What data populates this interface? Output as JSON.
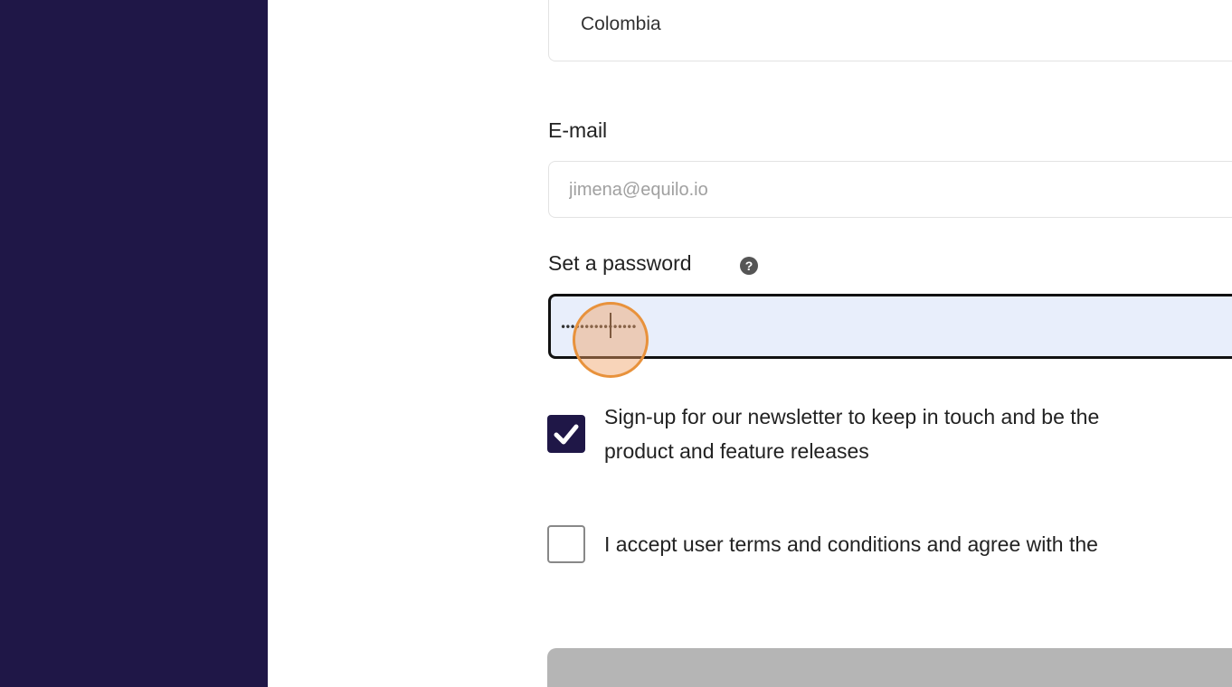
{
  "sidebar": {
    "background_color": "#1f1747"
  },
  "form": {
    "country": {
      "value": "Colombia"
    },
    "email": {
      "label": "E-mail",
      "placeholder": "jimena@equilo.io"
    },
    "password": {
      "label": "Set a password",
      "help_icon": "question-circle-icon",
      "value": "••••••••••••••••",
      "state": "focused"
    },
    "newsletter": {
      "checked": true,
      "text_line1": "Sign-up for our newsletter to keep in touch and be the",
      "text_line2": "product and feature releases"
    },
    "terms": {
      "checked": false,
      "text": "I accept user terms and conditions and agree with the"
    },
    "submit": {
      "state": "disabled",
      "color": "#b5b5b5"
    }
  },
  "colors": {
    "accent": "#1f1747",
    "focus_background": "#e8eefb",
    "click_indicator": "#e8923c"
  }
}
